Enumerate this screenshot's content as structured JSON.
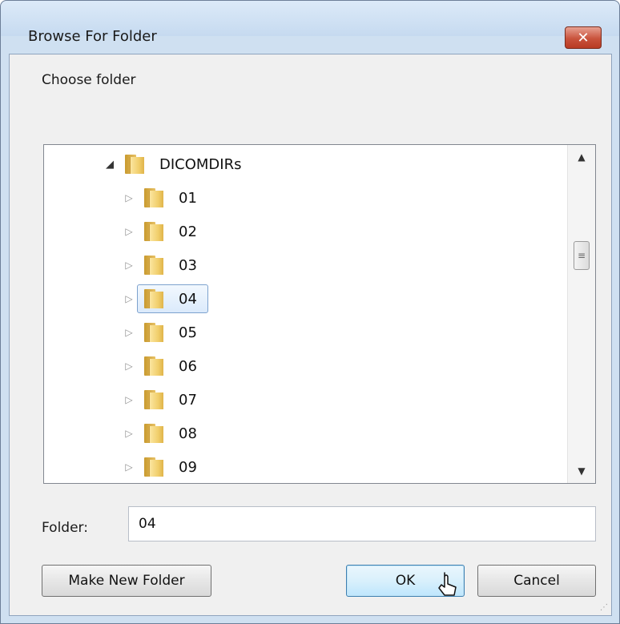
{
  "window": {
    "title": "Browse For Folder",
    "close_glyph": "✕"
  },
  "dialog": {
    "prompt": "Choose folder"
  },
  "tree": {
    "items": [
      {
        "label": "DICOMDIRs",
        "arrow": "◢",
        "expanded": true,
        "selected": false
      },
      {
        "label": "01",
        "arrow": "▷",
        "expanded": false,
        "selected": false
      },
      {
        "label": "02",
        "arrow": "▷",
        "expanded": false,
        "selected": false
      },
      {
        "label": "03",
        "arrow": "▷",
        "expanded": false,
        "selected": false
      },
      {
        "label": "04",
        "arrow": "▷",
        "expanded": false,
        "selected": true
      },
      {
        "label": "05",
        "arrow": "▷",
        "expanded": false,
        "selected": false
      },
      {
        "label": "06",
        "arrow": "▷",
        "expanded": false,
        "selected": false
      },
      {
        "label": "07",
        "arrow": "▷",
        "expanded": false,
        "selected": false
      },
      {
        "label": "08",
        "arrow": "▷",
        "expanded": false,
        "selected": false
      },
      {
        "label": "09",
        "arrow": "▷",
        "expanded": false,
        "selected": false
      }
    ],
    "scrollbar": {
      "up_glyph": "▲",
      "down_glyph": "▼",
      "thumb_glyph": "≡"
    }
  },
  "folder_field": {
    "label": "Folder:",
    "value": "04"
  },
  "buttons": {
    "make_new_folder": "Make New Folder",
    "ok": "OK",
    "cancel": "Cancel"
  },
  "colors": {
    "accent": "#3c7fb1",
    "selection": "#dbeafb",
    "close": "#c9533c"
  },
  "icons": {
    "tree_item": "folder-icon",
    "cursor": "mouse-pointer-icon"
  }
}
